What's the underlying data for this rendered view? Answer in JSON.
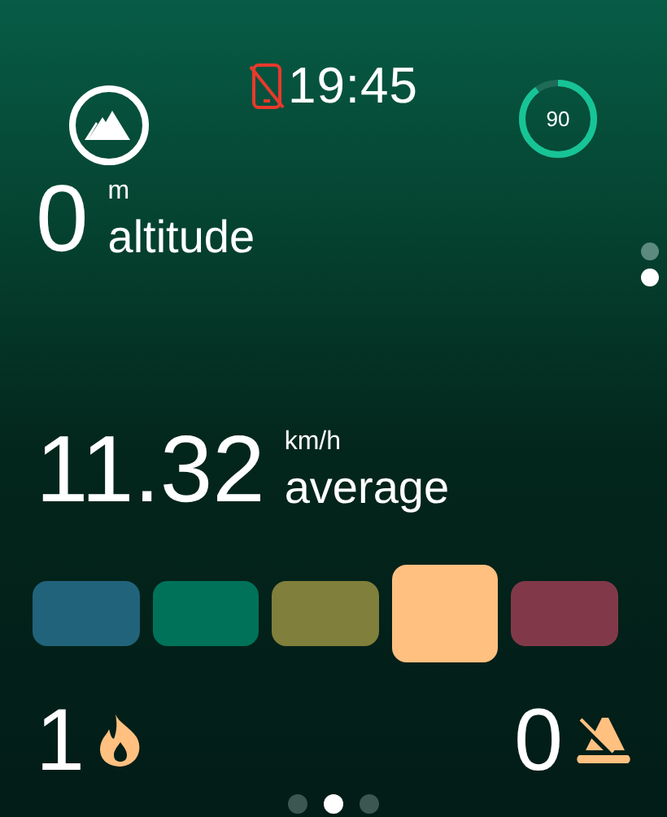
{
  "status": {
    "phone_disconnected": true,
    "time": "19:45"
  },
  "heart_ring": {
    "value": "90",
    "level": 0.9
  },
  "altitude": {
    "value": "0",
    "unit": "m",
    "label": "altitude"
  },
  "side_pages": [
    {
      "selected": false
    },
    {
      "selected": true
    }
  ],
  "speed": {
    "value": "11.32",
    "unit": "km/h",
    "label": "average"
  },
  "zones": [
    {
      "color": "#21637a",
      "selected": false
    },
    {
      "color": "#00725a",
      "selected": false
    },
    {
      "color": "#807f3b",
      "selected": false
    },
    {
      "color": "#ffc080",
      "selected": true
    },
    {
      "color": "#813949",
      "selected": false
    }
  ],
  "counters": [
    {
      "kind": "fire",
      "value": "1"
    },
    {
      "kind": "warning",
      "value": "0"
    }
  ],
  "pages": [
    {
      "selected": false
    },
    {
      "selected": true
    },
    {
      "selected": false
    }
  ]
}
